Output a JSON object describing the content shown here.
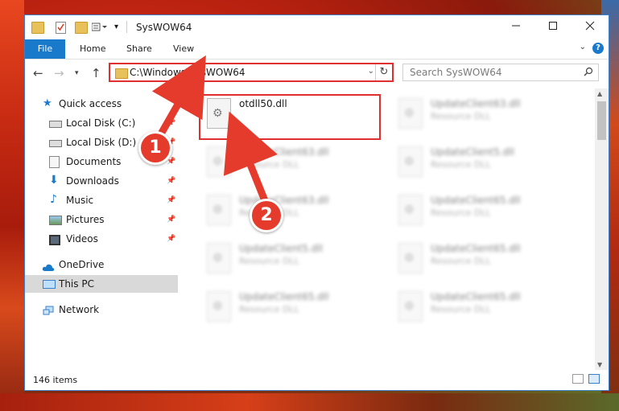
{
  "window": {
    "title": "SysWOW64",
    "minimize_icon": "minimize-icon",
    "maximize_icon": "maximize-icon",
    "close_icon": "close-icon"
  },
  "ribbon": {
    "tabs": [
      {
        "label": "File"
      },
      {
        "label": "Home"
      },
      {
        "label": "Share"
      },
      {
        "label": "View"
      }
    ],
    "help_label": "?"
  },
  "address_bar": {
    "path": "C:\\Windows\\SysWOW64"
  },
  "search": {
    "placeholder": "Search SysWOW64"
  },
  "sidebar": {
    "items": [
      {
        "label": "Quick access",
        "icon": "star-icon"
      },
      {
        "label": "Local Disk (C:)",
        "icon": "drive-icon"
      },
      {
        "label": "Local Disk (D:)",
        "icon": "drive-icon"
      },
      {
        "label": "Documents",
        "icon": "documents-icon"
      },
      {
        "label": "Downloads",
        "icon": "download-icon"
      },
      {
        "label": "Music",
        "icon": "music-icon"
      },
      {
        "label": "Pictures",
        "icon": "pictures-icon"
      },
      {
        "label": "Videos",
        "icon": "videos-icon"
      },
      {
        "label": "OneDrive",
        "icon": "cloud-icon"
      },
      {
        "label": "This PC",
        "icon": "computer-icon"
      },
      {
        "label": "Network",
        "icon": "network-icon"
      }
    ]
  },
  "files": [
    {
      "name": "otdll50.dll",
      "type": ""
    },
    {
      "name": "UpdateClient63.dll",
      "type": "Resource DLL"
    },
    {
      "name": "UpdateClient63.dll",
      "type": "Resource DLL"
    },
    {
      "name": "UpdateClient5.dll",
      "type": "Resource DLL"
    },
    {
      "name": "UpdateClient63.dll",
      "type": "Resource DLL"
    },
    {
      "name": "UpdateClient65.dll",
      "type": "Resource DLL"
    },
    {
      "name": "UpdateClient5.dll",
      "type": "Resource DLL"
    },
    {
      "name": "UpdateClient65.dll",
      "type": "Resource DLL"
    },
    {
      "name": "UpdateClient65.dll",
      "type": "Resource DLL"
    },
    {
      "name": "UpdateClient65.dll",
      "type": "Resource DLL"
    }
  ],
  "status": {
    "item_count": "146 items"
  },
  "callouts": {
    "one": "1",
    "two": "2"
  },
  "colors": {
    "accent": "#1979ca",
    "highlight_red": "#e02f2f",
    "callout_red": "#e53b2c"
  }
}
